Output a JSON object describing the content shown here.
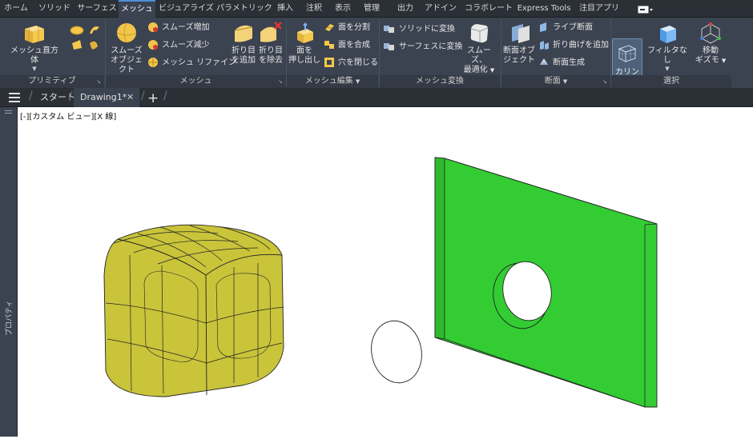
{
  "ribbon_tabs": [
    "ホーム",
    "ソリッド",
    "サーフェス",
    "メッシュ",
    "ビジュアライズ",
    "パラメトリック",
    "挿入",
    "注釈",
    "表示",
    "管理",
    "出力",
    "アドイン",
    "コラボレート",
    "Express Tools",
    "注目アプリ"
  ],
  "active_tab": "メッシュ",
  "panels": {
    "primitive": {
      "label": "プリミティブ",
      "mesh_box": "メッシュ直方体"
    },
    "mesh": {
      "label": "メッシュ",
      "smooth_object_l1": "スムーズ",
      "smooth_object_l2": "オブジェクト",
      "smooth_more": "スムーズ増加",
      "smooth_less": "スムーズ減少",
      "refine_mesh": "メッシュ リファイン"
    },
    "mesh_edit": {
      "label": "メッシュ編集",
      "add_crease_l1": "折り目",
      "add_crease_l2": "を追加",
      "remove_crease_l1": "折り目",
      "remove_crease_l2": "を除去",
      "extrude_face_l1": "面を",
      "extrude_face_l2": "押し出し",
      "split_face": "面を分割",
      "merge_face": "面を合成",
      "close_hole": "穴を閉じる"
    },
    "convert_mesh": {
      "label": "メッシュ変換",
      "to_solid": "ソリッドに変換",
      "to_surface": "サーフェスに変換",
      "smooth_opt_l1": "スムーズ、",
      "smooth_opt_l2": "最適化"
    },
    "section": {
      "label": "断面",
      "section_plane_l1": "断面オブ",
      "section_plane_l2": "ジェクト",
      "live_section": "ライブ断面",
      "add_jog": "折り曲げを追加",
      "generate_section": "断面生成"
    },
    "selection": {
      "label": "選択",
      "culling": "カリング",
      "no_filter": "フィルタなし",
      "move_gizmo_l1": "移動",
      "move_gizmo_l2": "ギズモ"
    }
  },
  "doc_tabs": {
    "start": "スタート",
    "drawing": "Drawing1*"
  },
  "side_palette": "プロパティ",
  "viewport_label": "[-][カスタム ビュー][X 線]",
  "colors": {
    "accent": "#4c90d8",
    "mesh_fill": "#c9c43a",
    "plate_fill": "#33cc33"
  }
}
